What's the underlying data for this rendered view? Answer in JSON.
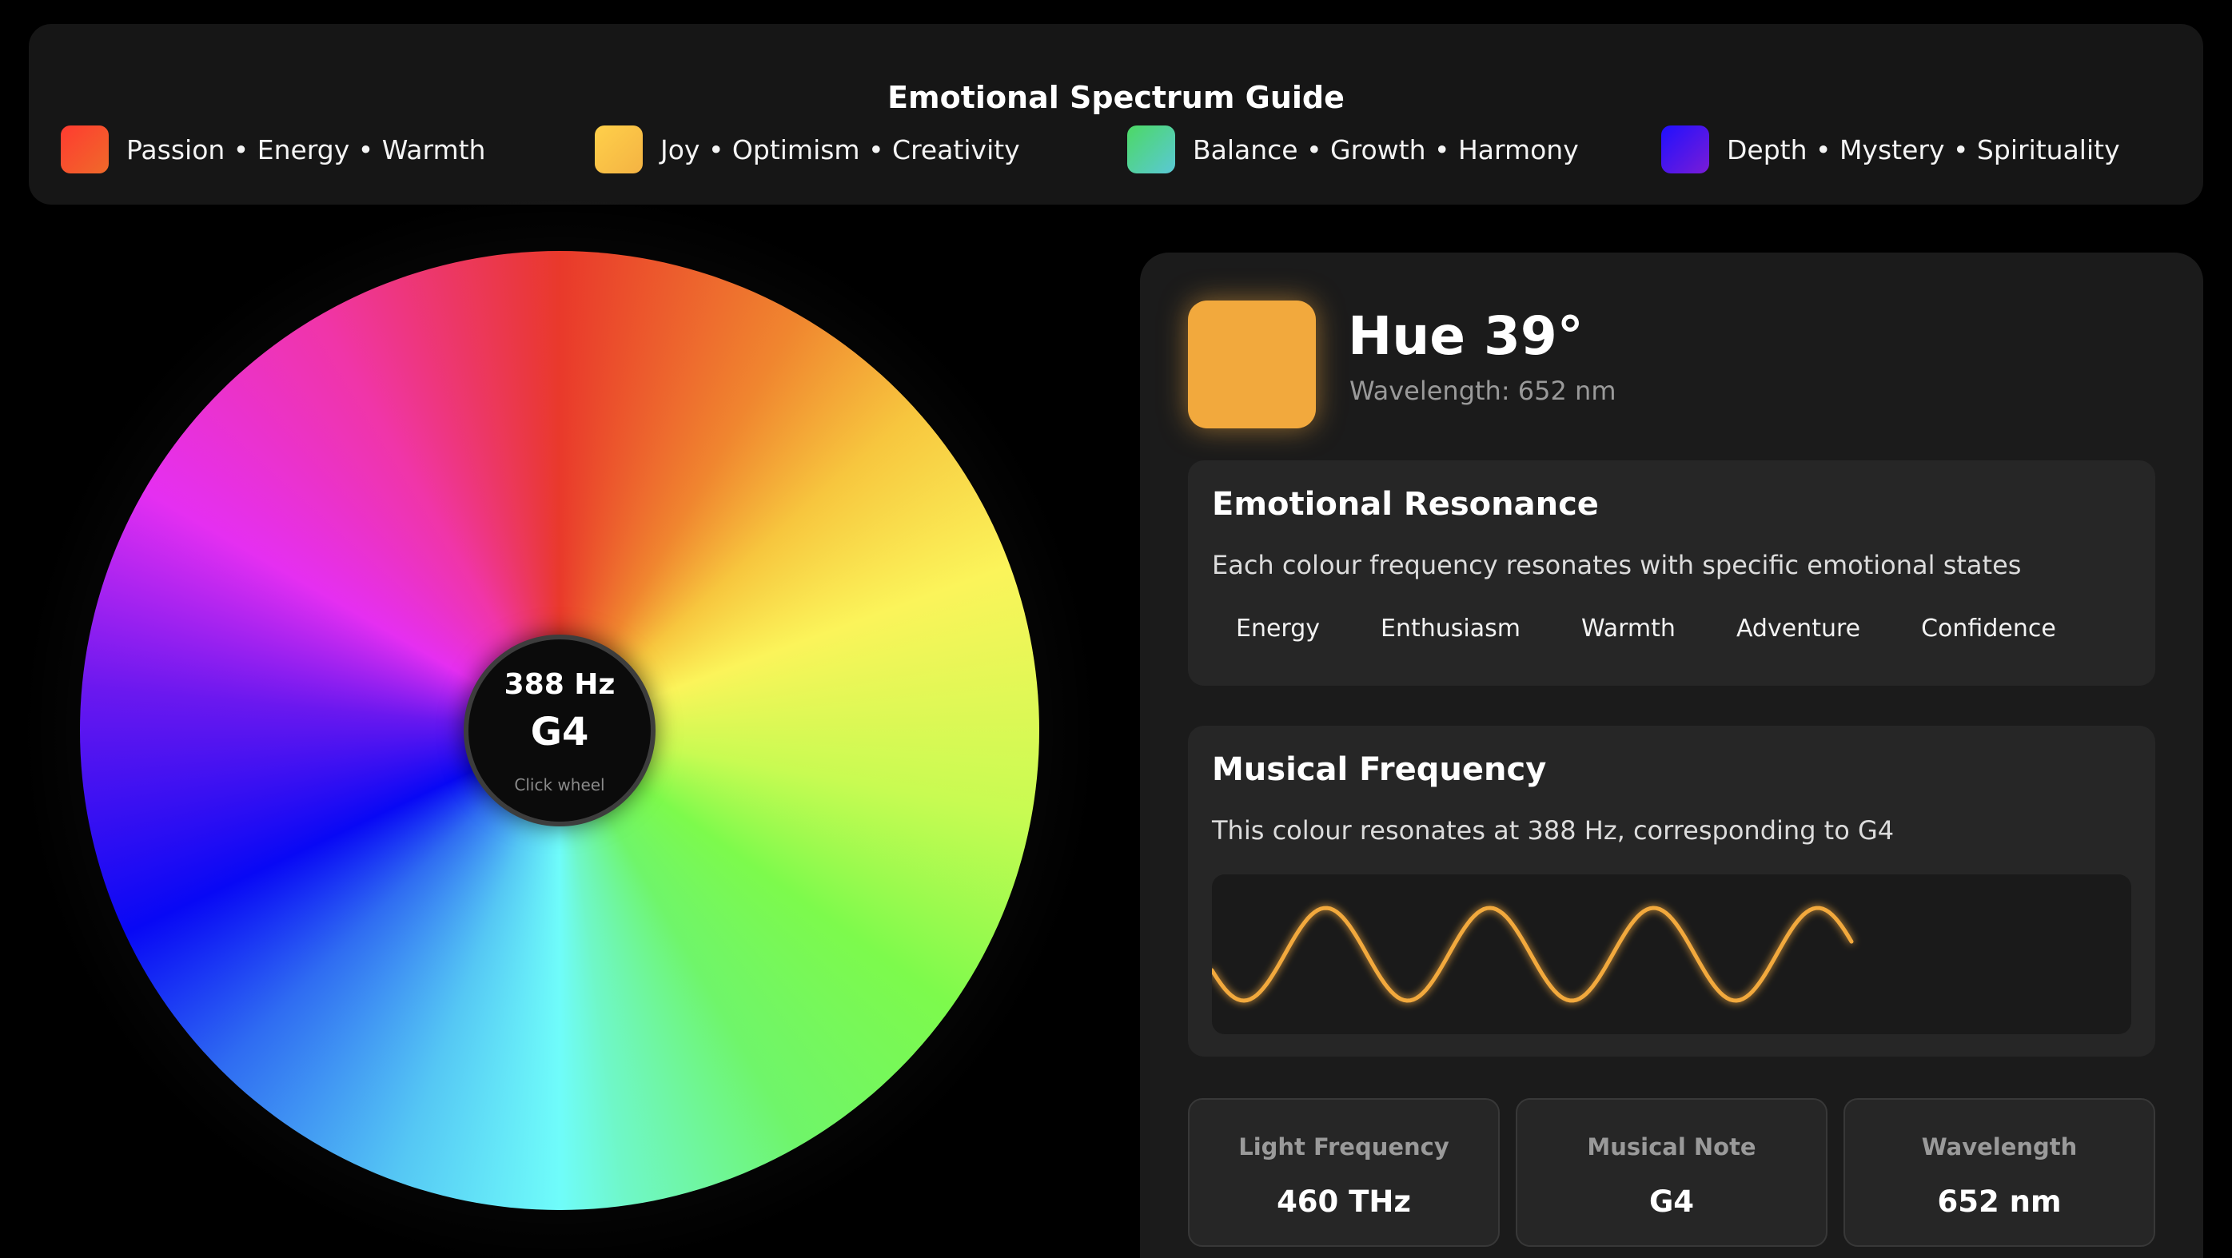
{
  "guide": {
    "title": "Emotional Spectrum Guide",
    "items": [
      {
        "label": "Passion • Energy • Warmth",
        "gradient": [
          "#ff3b30",
          "#ef6a2a"
        ]
      },
      {
        "label": "Joy • Optimism • Creativity",
        "gradient": [
          "#ffd04a",
          "#f4b343"
        ]
      },
      {
        "label": "Balance • Growth • Harmony",
        "gradient": [
          "#4cd964",
          "#5ac8d6"
        ]
      },
      {
        "label": "Depth • Mystery • Spirituality",
        "gradient": [
          "#1f10ff",
          "#7a1cd6"
        ]
      }
    ]
  },
  "wheel": {
    "frequency": "388 Hz",
    "note": "G4",
    "hint": "Click wheel"
  },
  "selection": {
    "title": "Hue 39°",
    "subtitle": "Wavelength: 652 nm",
    "color": "#f2a93d"
  },
  "emotion_card": {
    "title": "Emotional Resonance",
    "description": "Each colour frequency resonates with specific emotional states",
    "tags": [
      "Energy",
      "Enthusiasm",
      "Warmth",
      "Adventure",
      "Confidence"
    ]
  },
  "music_card": {
    "title": "Musical Frequency",
    "description": "This colour resonates at 388 Hz, corresponding to G4",
    "wave_color": "#f2a93d"
  },
  "stats": [
    {
      "label": "Light Frequency",
      "value": "460 THz"
    },
    {
      "label": "Musical Note",
      "value": "G4"
    },
    {
      "label": "Wavelength",
      "value": "652 nm"
    }
  ],
  "colors": {
    "background": "#000000",
    "panel": "#1b1b1b",
    "card": "#262626",
    "accent": "#f2a93d"
  }
}
